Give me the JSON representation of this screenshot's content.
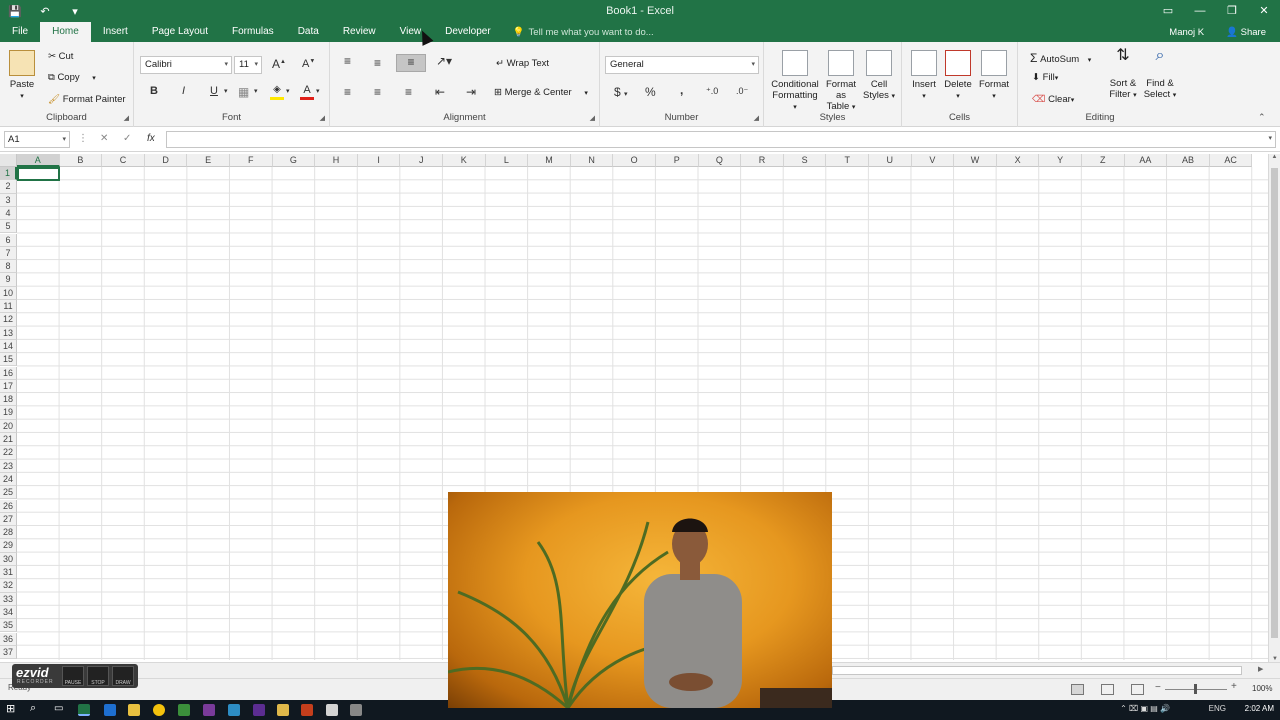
{
  "window": {
    "title": "Book1 - Excel",
    "user": "Manoj K",
    "share_label": "Share",
    "controls": [
      "▭",
      "—",
      "❐",
      "✕"
    ]
  },
  "quick_access": [
    "save-icon",
    "undo-icon",
    "customize-icon"
  ],
  "tabs": [
    {
      "label": "File"
    },
    {
      "label": "Home",
      "active": true
    },
    {
      "label": "Insert"
    },
    {
      "label": "Page Layout"
    },
    {
      "label": "Formulas"
    },
    {
      "label": "Data"
    },
    {
      "label": "Review"
    },
    {
      "label": "View"
    },
    {
      "label": "Developer"
    }
  ],
  "tell_me": "Tell me what you want to do...",
  "ribbon": {
    "clipboard": {
      "label": "Clipboard",
      "paste": "Paste",
      "cut": "Cut",
      "copy": "Copy",
      "format_painter": "Format Painter"
    },
    "font": {
      "label": "Font",
      "family": "Calibri",
      "size": "11",
      "bold": "B",
      "italic": "I",
      "underline": "U"
    },
    "alignment": {
      "label": "Alignment",
      "wrap_text": "Wrap Text",
      "merge_center": "Merge & Center"
    },
    "number": {
      "label": "Number",
      "format": "General",
      "currency": "$",
      "percent": "%",
      "comma": ","
    },
    "styles": {
      "label": "Styles",
      "conditional_1": "Conditional",
      "conditional_2": "Formatting",
      "format_table_1": "Format as",
      "format_table_2": "Table",
      "cell_styles_1": "Cell",
      "cell_styles_2": "Styles"
    },
    "cells": {
      "label": "Cells",
      "insert": "Insert",
      "delete": "Delete",
      "format": "Format"
    },
    "editing": {
      "label": "Editing",
      "autosum": "AutoSum",
      "fill": "Fill",
      "clear": "Clear",
      "sort_1": "Sort &",
      "sort_2": "Filter",
      "find_1": "Find &",
      "find_2": "Select"
    }
  },
  "formula_bar": {
    "name_box": "A1",
    "fx": "fx",
    "value": ""
  },
  "columns": [
    "A",
    "B",
    "C",
    "D",
    "E",
    "F",
    "G",
    "H",
    "I",
    "J",
    "K",
    "L",
    "M",
    "N",
    "O",
    "P",
    "Q",
    "R",
    "S",
    "T",
    "U",
    "V",
    "W",
    "X",
    "Y",
    "Z",
    "AA",
    "AB",
    "AC"
  ],
  "rows": [
    1,
    2,
    3,
    4,
    5,
    6,
    7,
    8,
    9,
    10,
    11,
    12,
    13,
    14,
    15,
    16,
    17,
    18,
    19,
    20,
    21,
    22,
    23,
    24,
    25,
    26,
    27,
    28,
    29,
    30,
    31,
    32,
    33,
    34,
    35,
    36,
    37
  ],
  "active_cell": "A1",
  "status": {
    "state": "Ready",
    "zoom": "100%"
  },
  "taskbar": {
    "language": "ENG",
    "time": "2:02 AM"
  },
  "recorder": {
    "brand": "ezvid",
    "sub": "RECORDER",
    "pause": "PAUSE",
    "stop": "STOP",
    "draw": "DRAW"
  },
  "colors": {
    "excel_green": "#217346",
    "ribbon_bg": "#f3f3f3"
  }
}
